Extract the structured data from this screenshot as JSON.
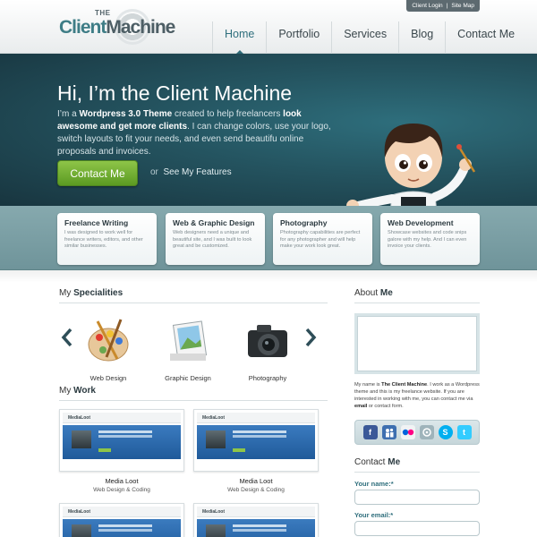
{
  "top_links": {
    "client_login": "Client Login",
    "separator": "|",
    "site_map": "Site Map"
  },
  "logo": {
    "the": "THE",
    "client": "Client",
    "machine": "Machine"
  },
  "nav": [
    {
      "label": "Home",
      "active": true
    },
    {
      "label": "Portfolio"
    },
    {
      "label": "Services"
    },
    {
      "label": "Blog"
    },
    {
      "label": "Contact Me"
    }
  ],
  "hero": {
    "title": "Hi, I’m the Client Machine",
    "intro_1": "I’m a ",
    "intro_bold_1": "Wordpress 3.0 Theme",
    "intro_2": " created to help freelancers ",
    "intro_bold_2": "look awesome and get more clients",
    "intro_3": ". I can change colors, use your logo, switch layouts to fit your needs, and even send beautifu online proposals and invoices.",
    "cta_label": "Contact Me",
    "or_text": "or",
    "features_link": "See My Features"
  },
  "services": [
    {
      "title": "Freelance Writing",
      "text": "I was designed to work well for freelance writers, editors, and other similar businesses."
    },
    {
      "title": "Web & Graphic Design",
      "text": "Web designers need a unique and beautiful site, and I was built to look great and be customized."
    },
    {
      "title": "Photography",
      "text": "Photography capabilities are perfect for any photographer and will help make your work look great."
    },
    {
      "title": "Web Development",
      "text": "Showcase websites and code snips galore with my help. And I can even invoice your clients."
    }
  ],
  "specialities": {
    "title_prefix": "My ",
    "title_bold": "Specialities",
    "items": [
      {
        "label": "Web Design"
      },
      {
        "label": "Graphic Design"
      },
      {
        "label": "Photography"
      }
    ]
  },
  "work": {
    "title_prefix": "My ",
    "title_bold": "Work",
    "items": [
      {
        "title": "Media Loot",
        "subtitle": "Web Design & Coding",
        "brand": "MediaLoot"
      },
      {
        "title": "Media Loot",
        "subtitle": "Web Design & Coding",
        "brand": "MediaLoot"
      },
      {
        "brand": "MediaLoot"
      },
      {
        "brand": "MediaLoot"
      }
    ]
  },
  "about": {
    "title_prefix": "About ",
    "title_bold": "Me",
    "text_1": "My name is ",
    "text_bold_1": "The Client Machine",
    "text_2": ". I work as a Wordpress theme and this is my freelance website. If you are interested in working with me, you can contact me via ",
    "text_bold_2": "email",
    "text_3": " or contact form."
  },
  "social_icons": [
    "facebook-icon",
    "myspace-icon",
    "flickr-icon",
    "lastfm-icon",
    "skype-icon",
    "twitter-icon"
  ],
  "contact": {
    "title_prefix": "Contact ",
    "title_bold": "Me",
    "name_label": "Your name:*",
    "email_label": "Your email:*"
  },
  "colors": {
    "accent": "#2e6e7c",
    "cta": "#6fae30",
    "hero_dark": "#18353f"
  }
}
